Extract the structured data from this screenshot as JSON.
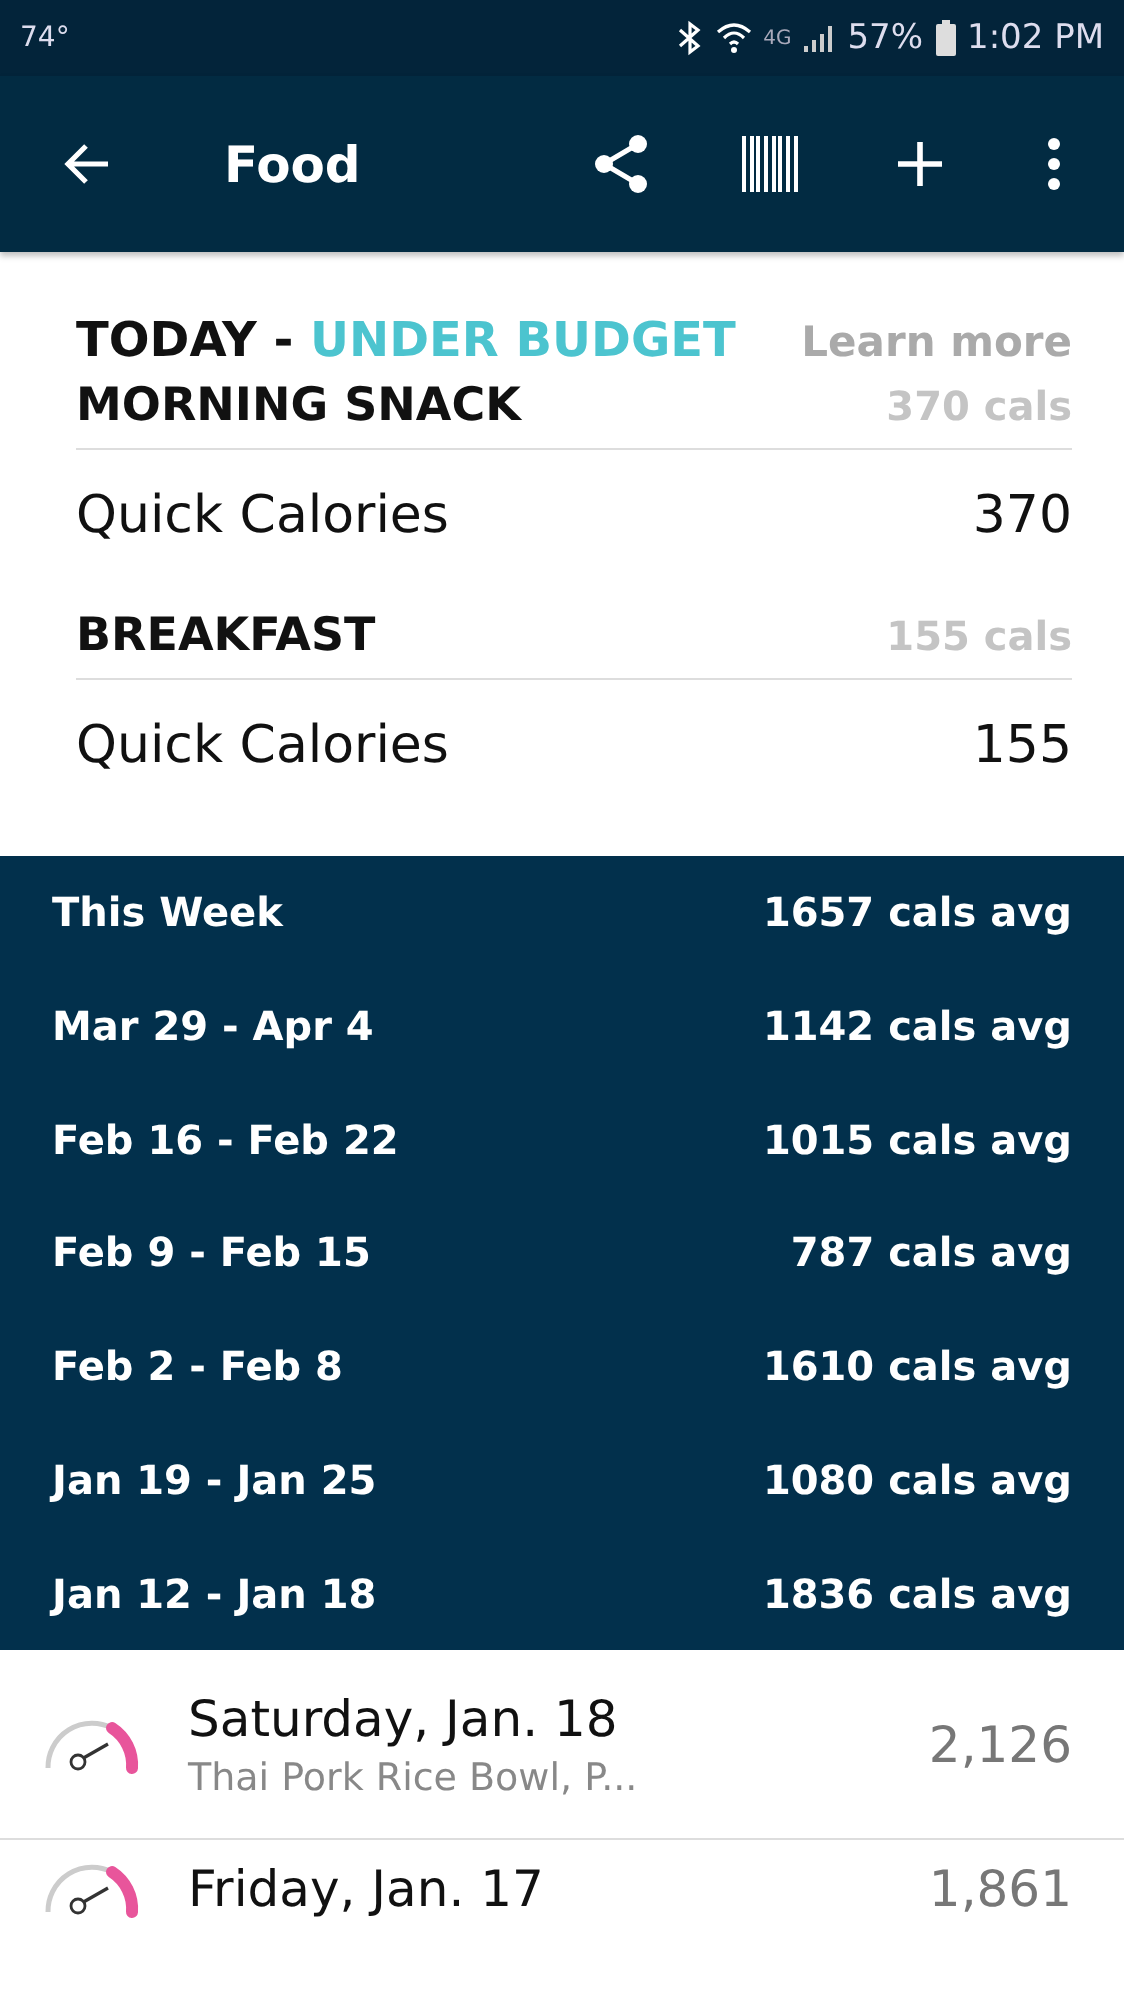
{
  "status_bar": {
    "temperature": "74°",
    "battery": "57%",
    "time": "1:02 PM",
    "network": "4G"
  },
  "toolbar": {
    "title": "Food"
  },
  "today": {
    "label": "TODAY - ",
    "status": "UNDER BUDGET",
    "link": "Learn more"
  },
  "meals": [
    {
      "name": "MORNING SNACK",
      "total": "370 cals",
      "items": [
        {
          "name": "Quick Calories",
          "calories": "370"
        }
      ]
    },
    {
      "name": "BREAKFAST",
      "total": "155 cals",
      "items": [
        {
          "name": "Quick Calories",
          "calories": "155"
        }
      ]
    }
  ],
  "weeks": [
    {
      "range": "This Week",
      "average": "1657 cals avg"
    },
    {
      "range": "Mar 29 - Apr 4",
      "average": "1142 cals avg"
    },
    {
      "range": "Feb 16 - Feb 22",
      "average": "1015 cals avg"
    },
    {
      "range": "Feb 9 - Feb 15",
      "average": "787 cals avg"
    },
    {
      "range": "Feb 2 - Feb 8",
      "average": "1610 cals avg"
    },
    {
      "range": "Jan 19 - Jan 25",
      "average": "1080 cals avg"
    },
    {
      "range": "Jan 12 - Jan 18",
      "average": "1836 cals avg"
    }
  ],
  "days": [
    {
      "date": "Saturday, Jan. 18",
      "foods": "Thai Pork Rice Bowl, P...",
      "calories": "2,126"
    },
    {
      "date": "Friday, Jan. 17",
      "calories": "1,861"
    }
  ]
}
